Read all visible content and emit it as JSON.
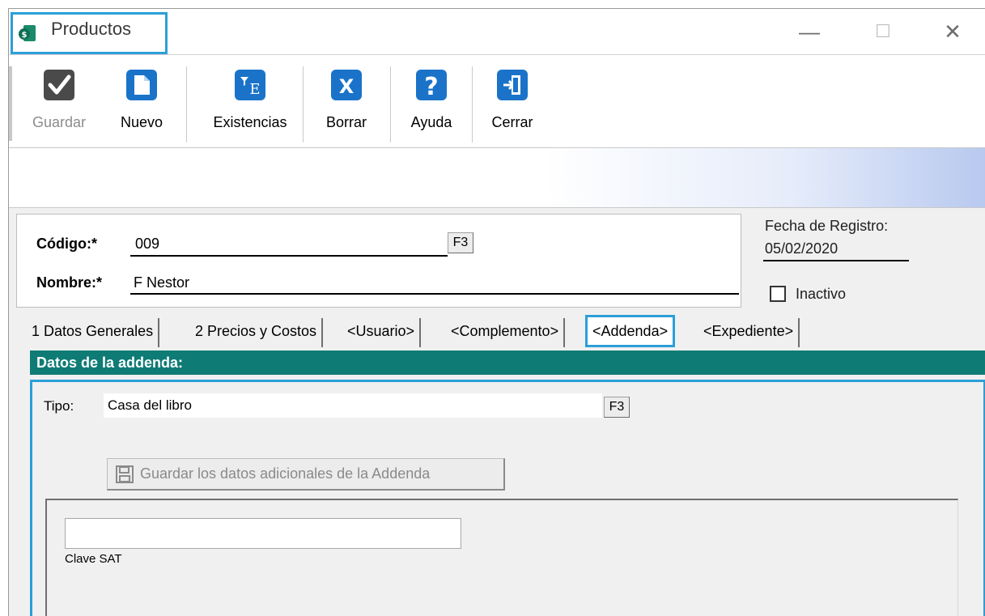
{
  "window": {
    "title": "Productos",
    "minimize_glyph": "—",
    "maximize_glyph": "☐",
    "close_glyph": "✕"
  },
  "toolbar": {
    "guardar": "Guardar",
    "nuevo": "Nuevo",
    "existencias": "Existencias",
    "borrar": "Borrar",
    "ayuda": "Ayuda",
    "cerrar": "Cerrar"
  },
  "header": {
    "codigo_label": "Código:*",
    "codigo_value": "009",
    "codigo_f3": "F3",
    "nombre_label": "Nombre:*",
    "nombre_value": "F Nestor",
    "fecha_label": "Fecha de Registro:",
    "fecha_value": "05/02/2020",
    "inactivo_label": "Inactivo"
  },
  "tabs": [
    {
      "label": "1 Datos Generales"
    },
    {
      "label": "2 Precios y Costos"
    },
    {
      "label": "<Usuario>"
    },
    {
      "label": "<Complemento>"
    },
    {
      "label": "<Addenda>",
      "active": true
    },
    {
      "label": "<Expediente>"
    }
  ],
  "addenda": {
    "section_title": "Datos de la addenda:",
    "tipo_label": "Tipo:",
    "tipo_value": "Casa del libro",
    "tipo_f3": "F3",
    "save_button": "Guardar los datos adicionales de la Addenda",
    "clave_value": "",
    "clave_label": "Clave SAT"
  },
  "colors": {
    "highlight": "#2b9fd8",
    "section_header": "#0f7b75",
    "toolbar_icon": "#1a73c9"
  }
}
